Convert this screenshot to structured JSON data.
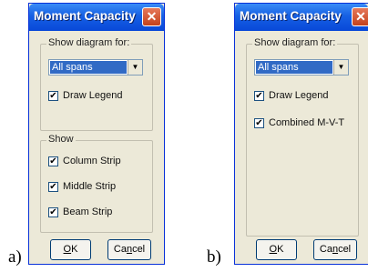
{
  "panel_a": {
    "label": "a)",
    "title": "Moment Capacity",
    "close_glyph": "✕",
    "show_diagram_group": "Show diagram for:",
    "dropdown_value": "All spans",
    "draw_legend_label": "Draw Legend",
    "draw_legend_checked": true,
    "show_group": "Show",
    "show_items": [
      {
        "label": "Column Strip",
        "checked": true
      },
      {
        "label": "Middle Strip",
        "checked": true
      },
      {
        "label": "Beam Strip",
        "checked": true
      }
    ],
    "ok_mnemonic": "O",
    "ok_rest": "K",
    "cancel_pre": "Ca",
    "cancel_mnemonic": "n",
    "cancel_post": "cel"
  },
  "panel_b": {
    "label": "b)",
    "title": "Moment Capacity",
    "close_glyph": "✕",
    "show_diagram_group": "Show diagram for:",
    "dropdown_value": "All spans",
    "draw_legend_label": "Draw Legend",
    "draw_legend_checked": true,
    "combined_label": "Combined M-V-T",
    "combined_checked": true,
    "ok_mnemonic": "O",
    "ok_rest": "K",
    "cancel_pre": "Ca",
    "cancel_mnemonic": "n",
    "cancel_post": "cel"
  },
  "colors": {
    "titlebar": "#0848d8",
    "face": "#ece9d8",
    "selection": "#316ac5",
    "close": "#c4421c"
  },
  "check_glyph": "✔",
  "arrow_glyph": "▼"
}
